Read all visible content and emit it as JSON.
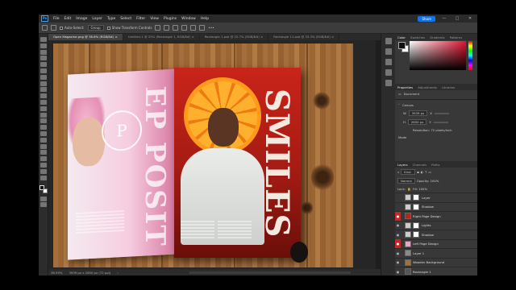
{
  "menubar": {
    "logo": "Ps",
    "items": [
      "File",
      "Edit",
      "Image",
      "Layer",
      "Type",
      "Select",
      "Filter",
      "View",
      "Plugins",
      "Window",
      "Help"
    ],
    "share": "Share",
    "controls": [
      "—",
      "□",
      "✕"
    ]
  },
  "options": {
    "auto_select": "Auto-Select:",
    "group": "Group",
    "show_transform": "Show Transform Controls",
    "more": "•••"
  },
  "tabs": [
    {
      "label": "Open Magazine.png @ 38.6% (RGB/8#) ×"
    },
    {
      "label": "Untitled-1 @ 25% (Rectangle 1, RGB/8#) ×"
    },
    {
      "label": "Rectangle 1.psb @ 22.7% (RGB/8#) ×"
    },
    {
      "label": "Rectangle 11.psb @ 33.3% (RGB/8#) ×"
    }
  ],
  "magazine": {
    "left_vertical": "EP POSIT",
    "circle_text": "P",
    "right_vertical": "SMILES"
  },
  "status": {
    "zoom": "38.59%",
    "dims": "3939 px x 2650 px (72 ppi)",
    "more": "›"
  },
  "panels": {
    "color_tabs": [
      "Color",
      "Swatches",
      "Gradients",
      "Patterns"
    ],
    "props_tabs": [
      "Properties",
      "Adjustments",
      "Libraries"
    ],
    "doc_label": "Document",
    "canvas_header": "Canvas",
    "width_label": "W",
    "width_value": "3939 px",
    "height_label": "H",
    "height_value": "2650 px",
    "x_label": "X",
    "y_label": "Y",
    "resolution": "Resolution: 72 pixels/inch",
    "mode": "Mode",
    "layers_tabs": [
      "Layers",
      "Channels",
      "Paths"
    ],
    "kind_label": "Kind",
    "blend_mode": "Normal",
    "opacity": "Opacity: 100%",
    "lock_label": "Lock:",
    "fill": "Fill: 100%"
  },
  "layers": [
    {
      "name": "Layer",
      "eye": "",
      "red": false,
      "sel": false,
      "mask": true
    },
    {
      "name": "Shadow",
      "eye": "",
      "red": false,
      "sel": false,
      "mask": true
    },
    {
      "name": "Right Page Design",
      "eye": "●",
      "red": true,
      "sel": false,
      "mask": false
    },
    {
      "name": "Lights",
      "eye": "●",
      "red": false,
      "sel": false,
      "mask": true
    },
    {
      "name": "Shadow",
      "eye": "●",
      "red": false,
      "sel": false,
      "mask": true
    },
    {
      "name": "Left Page Design",
      "eye": "●",
      "red": true,
      "sel": false,
      "mask": false
    },
    {
      "name": "Layer 1",
      "eye": "●",
      "red": false,
      "sel": false,
      "mask": false
    },
    {
      "name": "Wooden Background",
      "eye": "●",
      "red": false,
      "sel": false,
      "mask": false
    },
    {
      "name": "Rectangle 1",
      "eye": "●",
      "red": false,
      "sel": false,
      "mask": false
    }
  ],
  "colors": {
    "accent": "#1473e6",
    "red_badge": "#c62828",
    "panel_bg": "#383838",
    "canvas_bg": "#262626"
  }
}
